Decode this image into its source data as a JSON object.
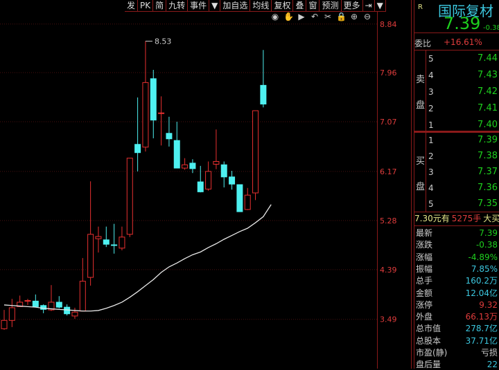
{
  "toolbar": [
    "发",
    "PK",
    "简",
    "九转",
    "事件",
    "▼",
    "加自选",
    "均线",
    "复权",
    "叠",
    "窗",
    "预测",
    "更多",
    "⇥",
    "▼"
  ],
  "chart_icons": [
    "eye-icon",
    "hand-icon",
    "play-circle-icon",
    "undo-icon",
    "scissors-icon",
    "lock-icon",
    "zoom-in-icon",
    "zoom-out-icon"
  ],
  "chart_data": {
    "type": "candlestick",
    "y_ticks": [
      "8.84",
      "7.96",
      "7.07",
      "6.17",
      "5.28",
      "4.39",
      "3.49"
    ],
    "ylim": [
      3.2,
      8.95
    ],
    "max_label": "8.53",
    "candles": [
      [
        3.32,
        3.66,
        3.3,
        3.47
      ],
      [
        3.47,
        3.86,
        3.35,
        3.7
      ],
      [
        3.72,
        3.92,
        3.72,
        3.8
      ],
      [
        3.82,
        3.86,
        3.75,
        3.83
      ],
      [
        3.82,
        3.94,
        3.71,
        3.72
      ],
      [
        3.74,
        3.76,
        3.6,
        3.67
      ],
      [
        3.66,
        4.11,
        3.64,
        3.8
      ],
      [
        3.8,
        3.91,
        3.69,
        3.71
      ],
      [
        3.71,
        3.76,
        3.56,
        3.59
      ],
      [
        3.55,
        3.7,
        3.5,
        3.62
      ],
      [
        3.64,
        4.6,
        3.64,
        4.18
      ],
      [
        4.25,
        5.99,
        4.1,
        5.03
      ],
      [
        4.95,
        5.17,
        4.7,
        4.99
      ],
      [
        4.93,
        5.17,
        4.8,
        4.85
      ],
      [
        4.84,
        5.22,
        4.68,
        4.83
      ],
      [
        4.78,
        5.17,
        4.74,
        4.98
      ],
      [
        5.03,
        6.41,
        4.98,
        6.41
      ],
      [
        6.66,
        7.51,
        6.17,
        6.51
      ],
      [
        6.61,
        8.53,
        6.53,
        7.78
      ],
      [
        7.85,
        8.01,
        6.77,
        7.1
      ],
      [
        7.22,
        7.53,
        6.64,
        7.23
      ],
      [
        6.86,
        7.16,
        6.62,
        6.76
      ],
      [
        6.73,
        7.07,
        6.23,
        6.23
      ],
      [
        6.23,
        6.41,
        6.2,
        6.29
      ],
      [
        6.32,
        6.39,
        6.14,
        6.22
      ],
      [
        5.98,
        6.27,
        5.79,
        5.8
      ],
      [
        5.85,
        6.35,
        5.82,
        6.17
      ],
      [
        6.3,
        6.93,
        6.21,
        6.35
      ],
      [
        6.29,
        6.35,
        5.88,
        6.07
      ],
      [
        6.07,
        6.18,
        5.84,
        5.94
      ],
      [
        5.93,
        5.93,
        5.44,
        5.44
      ],
      [
        5.48,
        5.87,
        5.47,
        5.74
      ],
      [
        5.78,
        7.27,
        5.65,
        7.27
      ],
      [
        7.73,
        8.37,
        7.33,
        7.39
      ]
    ],
    "ma": [
      3.75,
      3.74,
      3.73,
      3.72,
      3.71,
      3.69,
      3.68,
      3.67,
      3.66,
      3.65,
      3.64,
      3.64,
      3.65,
      3.69,
      3.74,
      3.8,
      3.89,
      3.99,
      4.1,
      4.21,
      4.34,
      4.44,
      4.51,
      4.59,
      4.66,
      4.71,
      4.79,
      4.86,
      4.94,
      5.01,
      5.08,
      5.14,
      5.24,
      5.35,
      5.57
    ],
    "colors": {
      "up": "#e83030",
      "down": "#4ef0f0",
      "ma": "#e8e8e8"
    }
  },
  "quote": {
    "flag": "R",
    "name": "国际复材",
    "price": "7.39",
    "change": "-0.38",
    "weibi_label": "委比",
    "weibi": "+16.61%",
    "sell_label": [
      "卖",
      "盘"
    ],
    "buy_label": [
      "买",
      "盘"
    ],
    "sell": [
      [
        "5",
        "7.44"
      ],
      [
        "4",
        "7.43"
      ],
      [
        "3",
        "7.42"
      ],
      [
        "2",
        "7.41"
      ],
      [
        "1",
        "7.40"
      ]
    ],
    "buy": [
      [
        "1",
        "7.39"
      ],
      [
        "2",
        "7.38"
      ],
      [
        "3",
        "7.37"
      ],
      [
        "4",
        "7.36"
      ],
      [
        "5",
        "7.35"
      ]
    ],
    "ticker_a": "7.30元有",
    "ticker_b": "5275手",
    "ticker_c": "大买",
    "stats": [
      {
        "label": "最新",
        "value": "7.39",
        "color": "#1ed01e"
      },
      {
        "label": "涨跌",
        "value": "-0.38",
        "color": "#1ed01e"
      },
      {
        "label": "涨幅",
        "value": "-4.89%",
        "color": "#1ed01e"
      },
      {
        "label": "振幅",
        "value": "7.85%",
        "color": "#3cc8e0"
      },
      {
        "label": "总手",
        "value": "160.2万",
        "color": "#3cc8e0"
      },
      {
        "label": "金额",
        "value": "12.04亿",
        "color": "#3cc8e0"
      },
      {
        "label": "涨停",
        "value": "9.32",
        "color": "#e03c3c"
      },
      {
        "label": "外盘",
        "value": "66.13万",
        "color": "#e03c3c"
      },
      {
        "label": "总市值",
        "value": "278.7亿",
        "color": "#3cc8e0"
      },
      {
        "label": "总股本",
        "value": "37.71亿",
        "color": "#3cc8e0"
      },
      {
        "label": "市盈(静)",
        "value": "亏损",
        "color": "#ccc"
      },
      {
        "label": "盘后量",
        "value": "22",
        "color": "#3cc8e0"
      }
    ]
  }
}
